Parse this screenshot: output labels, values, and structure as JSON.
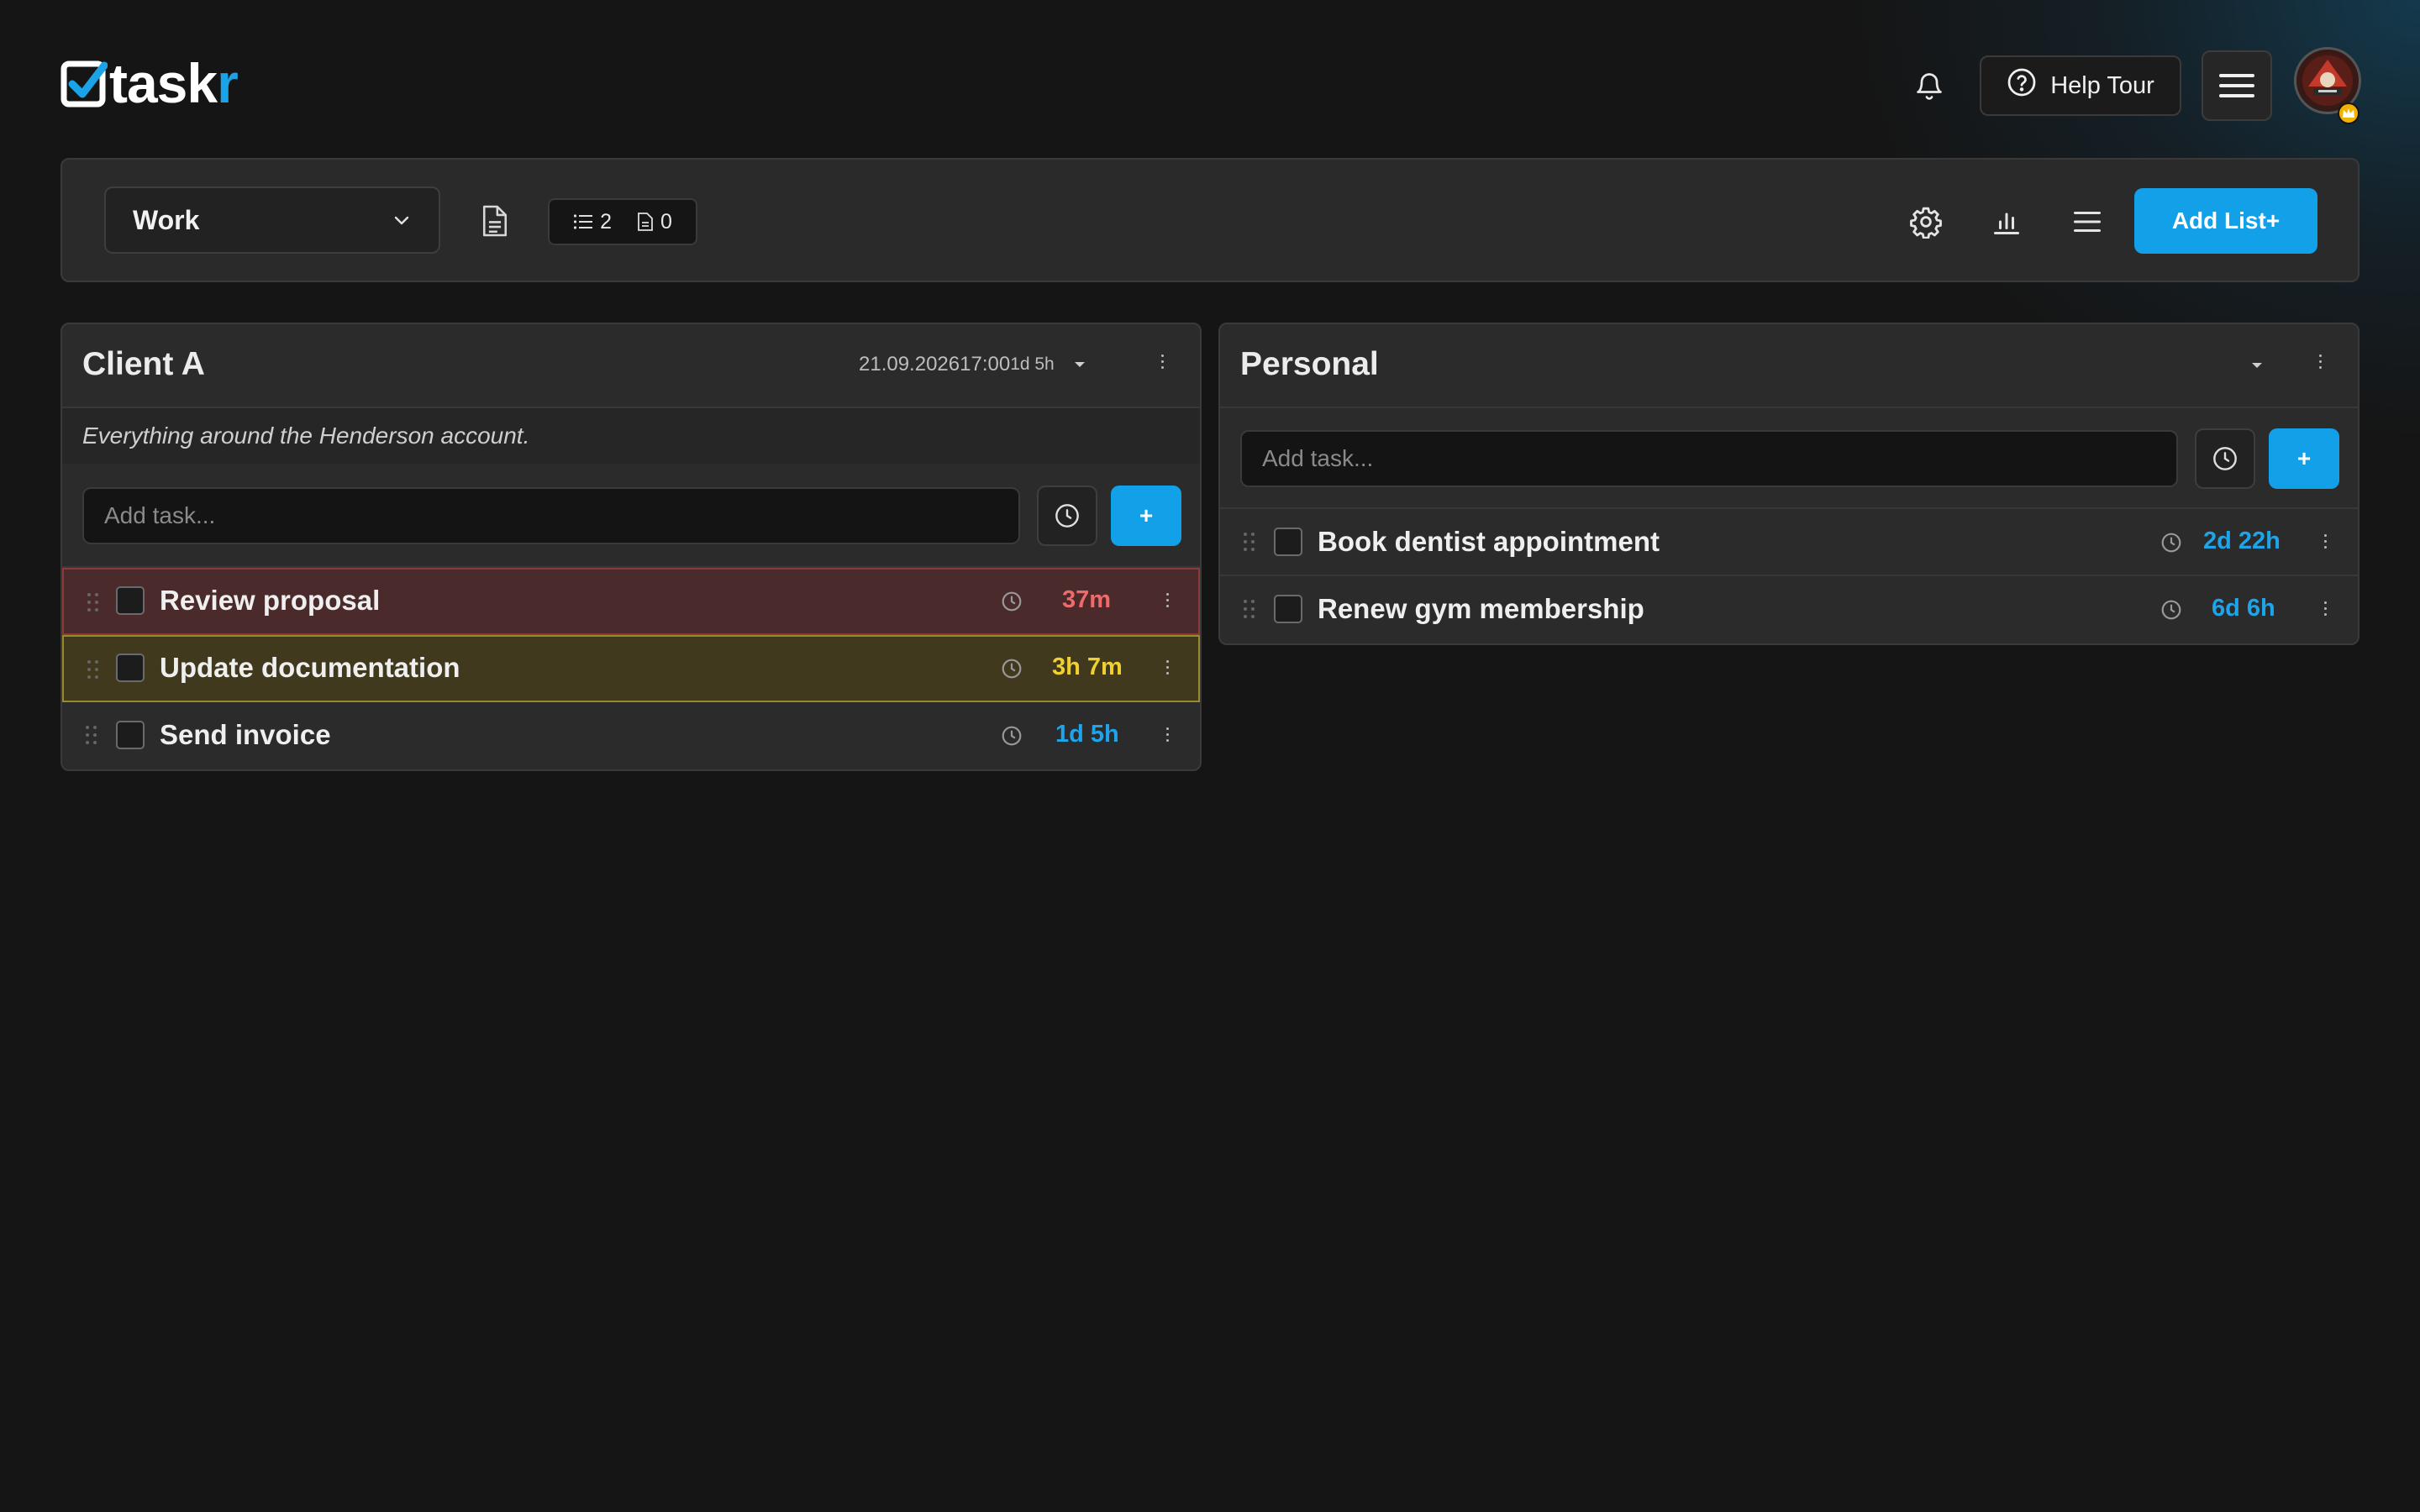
{
  "header": {
    "logo": {
      "text_main": "task",
      "text_accent": "r"
    },
    "help_tour_label": "Help Tour",
    "icons": {
      "bell": "bell-icon",
      "help": "help-circle-icon",
      "menu": "hamburger-menu-icon"
    },
    "accent_color": "#12a0e8"
  },
  "toolbar": {
    "board_selected": "Work",
    "counts": {
      "lists": "2",
      "notes": "0"
    },
    "add_list_label": "Add List+"
  },
  "lists": [
    {
      "title": "Client A",
      "due_date": "21.09.202617:00",
      "due_remaining": "1d 5h",
      "description": "Everything around the Henderson account.",
      "add_placeholder": "Add task...",
      "add_button": "+",
      "tasks": [
        {
          "name": "Review proposal",
          "due": "37m",
          "status": "overdue-soon",
          "color": "#f06a6a"
        },
        {
          "name": "Update documentation",
          "due": "3h 7m",
          "status": "warning",
          "color": "#f0d030"
        },
        {
          "name": "Send invoice",
          "due": "1d 5h",
          "status": "normal",
          "color": "#1fa4ea"
        }
      ]
    },
    {
      "title": "Personal",
      "add_placeholder": "Add task...",
      "add_button": "+",
      "tasks": [
        {
          "name": "Book dentist appointment",
          "due": "2d 22h",
          "status": "normal",
          "color": "#1fa4ea"
        },
        {
          "name": "Renew gym membership",
          "due": "6d 6h",
          "status": "normal",
          "color": "#1fa4ea"
        }
      ]
    }
  ]
}
